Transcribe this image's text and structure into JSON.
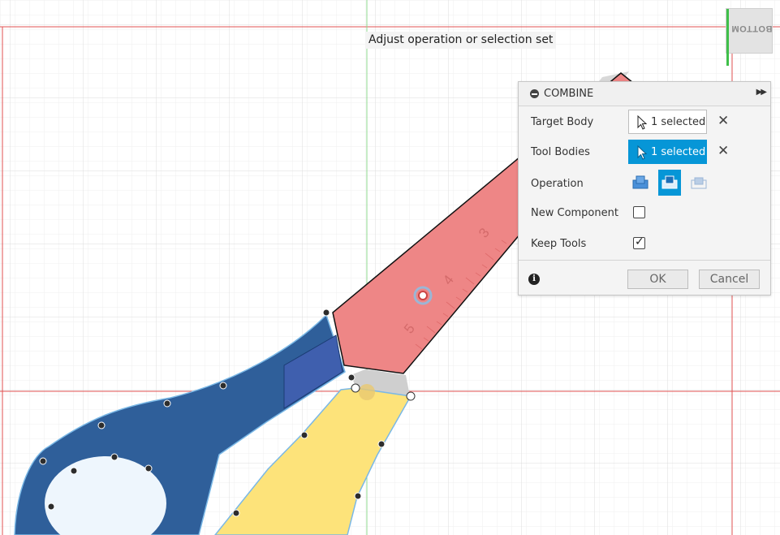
{
  "tooltip": {
    "text": "Adjust operation or selection set"
  },
  "viewcube": {
    "face_label": "BOTTOM"
  },
  "combine_panel": {
    "title": "COMBINE",
    "target_body": {
      "label": "Target Body",
      "value": "1 selected"
    },
    "tool_bodies": {
      "label": "Tool Bodies",
      "value": "1 selected"
    },
    "operation": {
      "label": "Operation",
      "options": [
        "join-icon",
        "cut-icon",
        "intersect-icon"
      ],
      "selected": "cut-icon"
    },
    "new_component": {
      "label": "New Component",
      "checked": false
    },
    "keep_tools": {
      "label": "Keep Tools",
      "checked": true,
      "check_glyph": "✓"
    },
    "ok_label": "OK",
    "cancel_label": "Cancel",
    "info_glyph": "i"
  },
  "ruler_marks": [
    "3",
    "4",
    "5"
  ],
  "colors": {
    "accent": "#0696d7",
    "blade_red": "#ee8686",
    "handle_blue": "#2f5f9a",
    "handle_yellow": "#fde37a",
    "grid_red": "#e05050"
  }
}
